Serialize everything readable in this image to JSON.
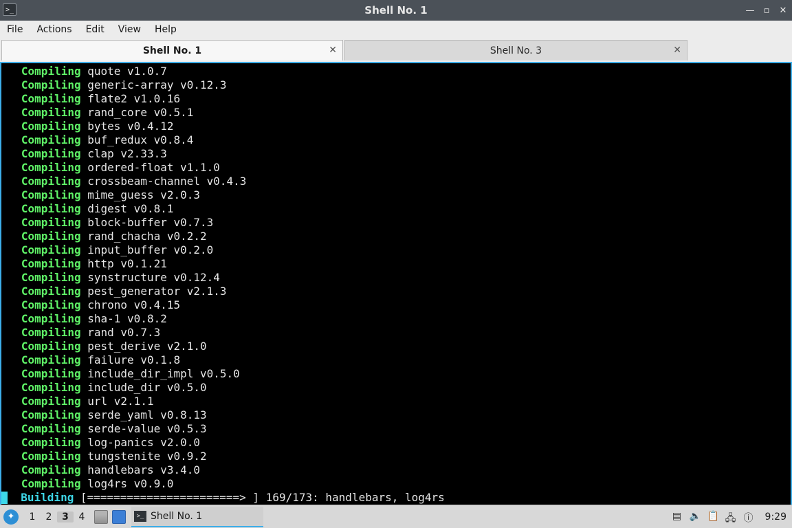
{
  "window": {
    "title": "Shell No. 1",
    "app_icon": ">_",
    "buttons": {
      "minimize": "—",
      "maximize": "▫",
      "close": "✕"
    }
  },
  "menu": [
    "File",
    "Actions",
    "Edit",
    "View",
    "Help"
  ],
  "tabs": [
    {
      "label": "Shell No. 1",
      "active": true
    },
    {
      "label": "Shell No. 3",
      "active": false
    }
  ],
  "terminal": {
    "lines": [
      {
        "status": "Compiling",
        "text": "quote v1.0.7"
      },
      {
        "status": "Compiling",
        "text": "generic-array v0.12.3"
      },
      {
        "status": "Compiling",
        "text": "flate2 v1.0.16"
      },
      {
        "status": "Compiling",
        "text": "rand_core v0.5.1"
      },
      {
        "status": "Compiling",
        "text": "bytes v0.4.12"
      },
      {
        "status": "Compiling",
        "text": "buf_redux v0.8.4"
      },
      {
        "status": "Compiling",
        "text": "clap v2.33.3"
      },
      {
        "status": "Compiling",
        "text": "ordered-float v1.1.0"
      },
      {
        "status": "Compiling",
        "text": "crossbeam-channel v0.4.3"
      },
      {
        "status": "Compiling",
        "text": "mime_guess v2.0.3"
      },
      {
        "status": "Compiling",
        "text": "digest v0.8.1"
      },
      {
        "status": "Compiling",
        "text": "block-buffer v0.7.3"
      },
      {
        "status": "Compiling",
        "text": "rand_chacha v0.2.2"
      },
      {
        "status": "Compiling",
        "text": "input_buffer v0.2.0"
      },
      {
        "status": "Compiling",
        "text": "http v0.1.21"
      },
      {
        "status": "Compiling",
        "text": "synstructure v0.12.4"
      },
      {
        "status": "Compiling",
        "text": "pest_generator v2.1.3"
      },
      {
        "status": "Compiling",
        "text": "chrono v0.4.15"
      },
      {
        "status": "Compiling",
        "text": "sha-1 v0.8.2"
      },
      {
        "status": "Compiling",
        "text": "rand v0.7.3"
      },
      {
        "status": "Compiling",
        "text": "pest_derive v2.1.0"
      },
      {
        "status": "Compiling",
        "text": "failure v0.1.8"
      },
      {
        "status": "Compiling",
        "text": "include_dir_impl v0.5.0"
      },
      {
        "status": "Compiling",
        "text": "include_dir v0.5.0"
      },
      {
        "status": "Compiling",
        "text": "url v2.1.1"
      },
      {
        "status": "Compiling",
        "text": "serde_yaml v0.8.13"
      },
      {
        "status": "Compiling",
        "text": "serde-value v0.5.3"
      },
      {
        "status": "Compiling",
        "text": "log-panics v2.0.0"
      },
      {
        "status": "Compiling",
        "text": "tungstenite v0.9.2"
      },
      {
        "status": "Compiling",
        "text": "handlebars v3.4.0"
      },
      {
        "status": "Compiling",
        "text": "log4rs v0.9.0"
      }
    ],
    "progress": {
      "status": "Building",
      "bar": "[=======================> ]",
      "text": "169/173: handlebars, log4rs"
    }
  },
  "taskbar": {
    "workspaces": [
      "1",
      "2",
      "3",
      "4"
    ],
    "active_workspace": "3",
    "task_label": "Shell No. 1",
    "clock": "9:29",
    "tray_icons": [
      "package-icon",
      "volume-icon",
      "clipboard-icon",
      "network-icon",
      "notification-icon"
    ]
  }
}
